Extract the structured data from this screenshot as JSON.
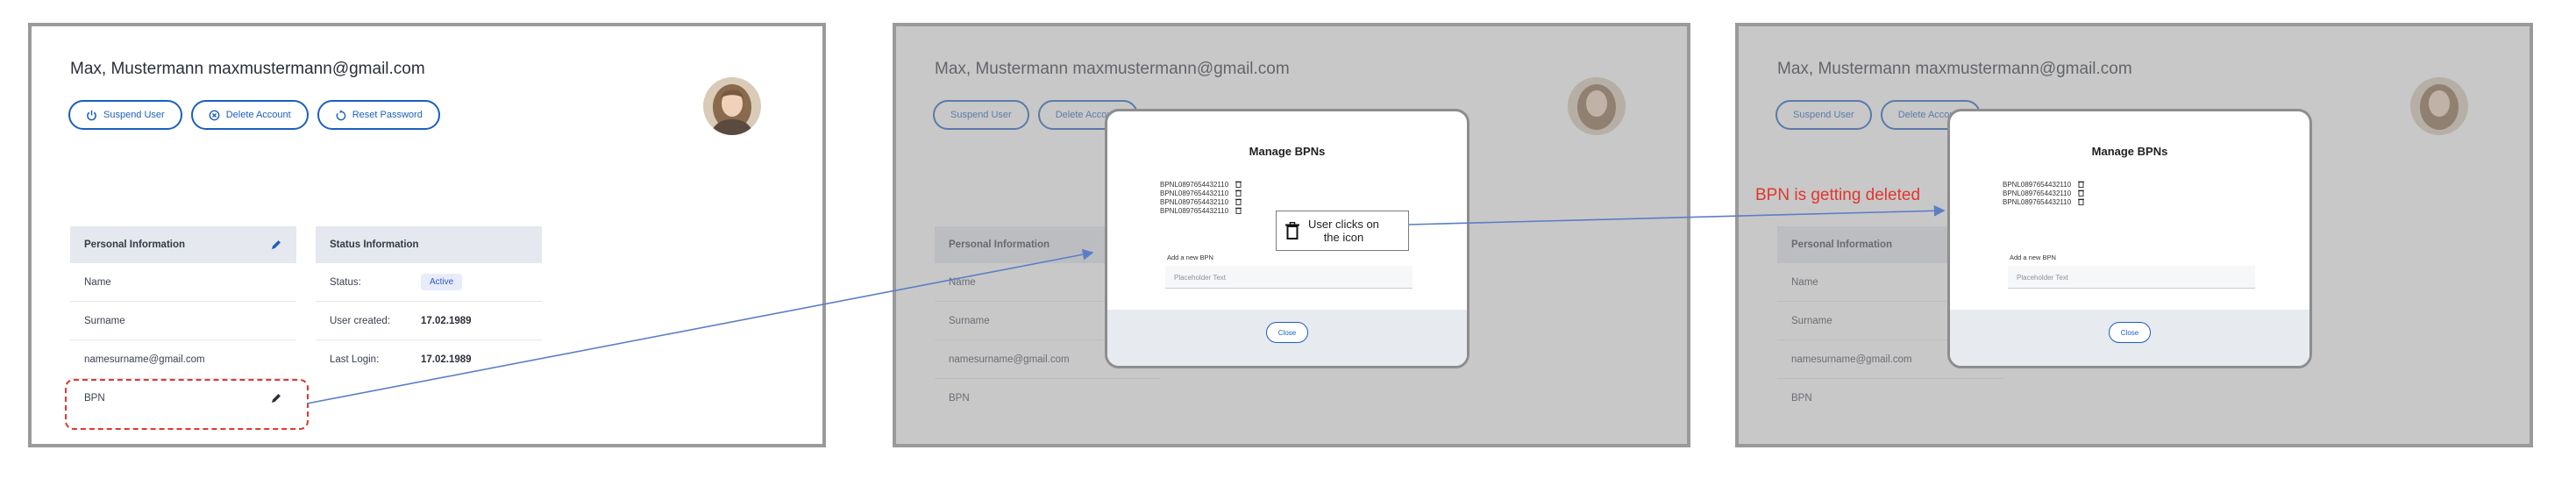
{
  "user": {
    "name_email": "Max, Mustermann maxmustermann@gmail.com"
  },
  "actions": {
    "suspend": "Suspend User",
    "delete": "Delete Account",
    "reset": "Reset Password"
  },
  "personal": {
    "header": "Personal Information",
    "rows": [
      "Name",
      "Surname",
      "namesurname@gmail.com",
      "BPN"
    ]
  },
  "status": {
    "header": "Status Information",
    "status_label": "Status:",
    "status_value": "Active",
    "created_label": "User created:",
    "created_value": "17.02.1989",
    "login_label": "Last Login:",
    "login_value": "17.02.1989"
  },
  "modal": {
    "title": "Manage BPNs",
    "bpns_before": [
      "BPNL0897654432110",
      "BPNL0897654432110",
      "BPNL0897654432110",
      "BPNL0897654432110"
    ],
    "bpns_after": [
      "BPNL0897654432110",
      "BPNL0897654432110",
      "BPNL0897654432110"
    ],
    "add_label": "Add a new BPN",
    "placeholder": "Placeholder Text",
    "close": "Close"
  },
  "annotations": {
    "user_clicks_line1": "User clicks on",
    "user_clicks_line2": "the icon",
    "deleting": "BPN is getting deleted"
  },
  "colors": {
    "accent": "#1b5fbf",
    "annotation_red": "#e0362e",
    "arrow_blue": "#5b7ec7"
  },
  "icons": [
    "power-icon",
    "close-circle-icon",
    "reset-icon",
    "pencil-icon",
    "trash-icon"
  ]
}
